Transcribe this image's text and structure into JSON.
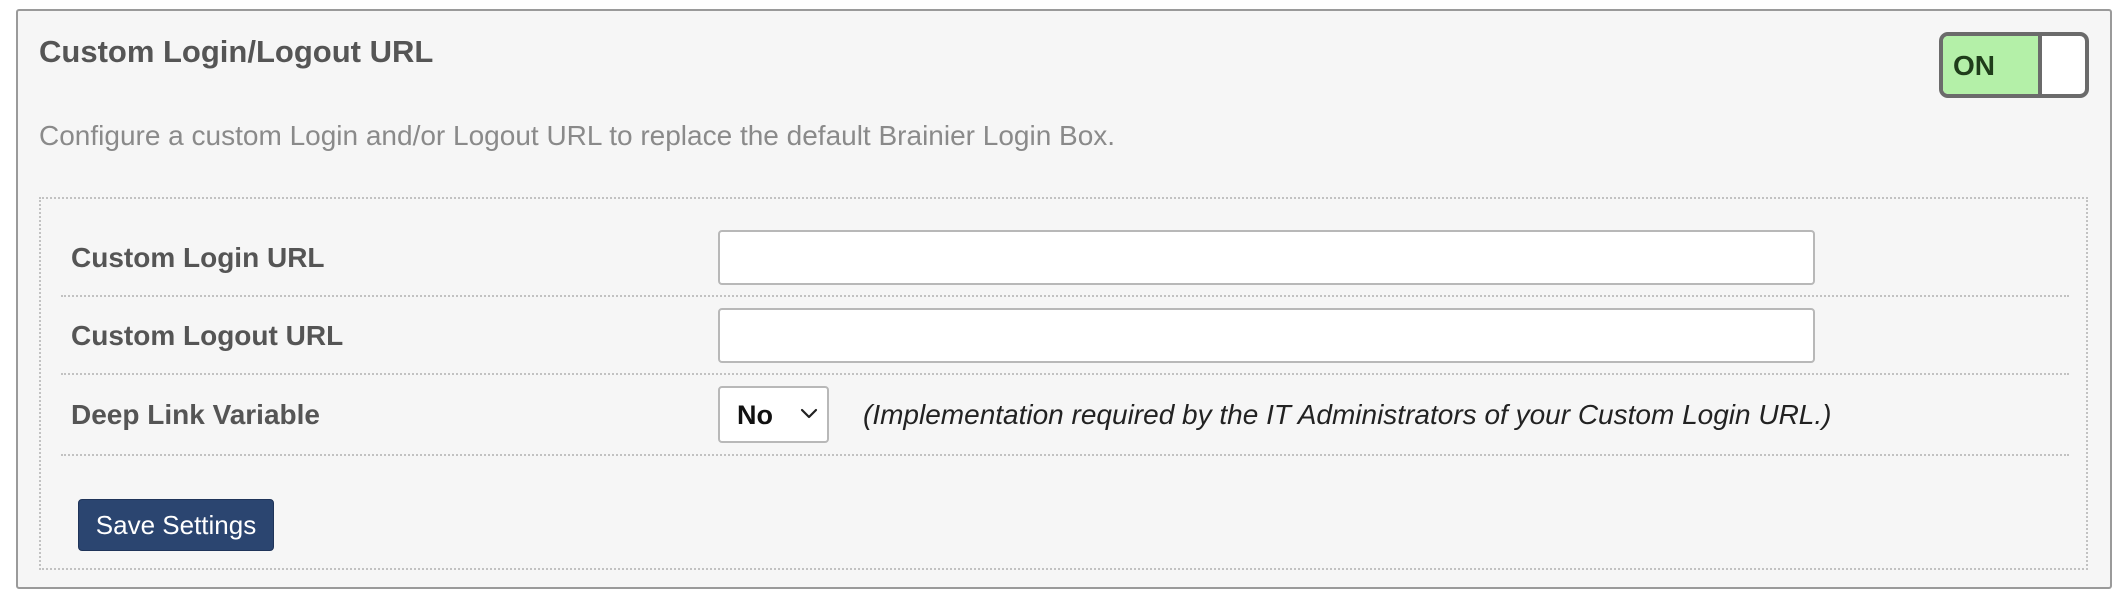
{
  "panel": {
    "title": "Custom Login/Logout URL",
    "description": "Configure a custom Login and/or Logout URL to replace the default Brainier Login Box.",
    "toggle": {
      "label": "ON",
      "state": "on",
      "color": "#b4f0a8"
    }
  },
  "settings": {
    "login_url": {
      "label": "Custom Login URL",
      "value": "",
      "placeholder": ""
    },
    "logout_url": {
      "label": "Custom Logout URL",
      "value": "",
      "placeholder": ""
    },
    "deep_link": {
      "label": "Deep Link Variable",
      "selected": "No",
      "icon": "chevron-down-icon",
      "note": "(Implementation required by the IT Administrators of your Custom Login URL.)"
    },
    "save_label": "Save Settings"
  },
  "colors": {
    "panel_background": "#f6f6f6",
    "button": "#2b4570",
    "toggle_on": "#b4f0a8"
  }
}
